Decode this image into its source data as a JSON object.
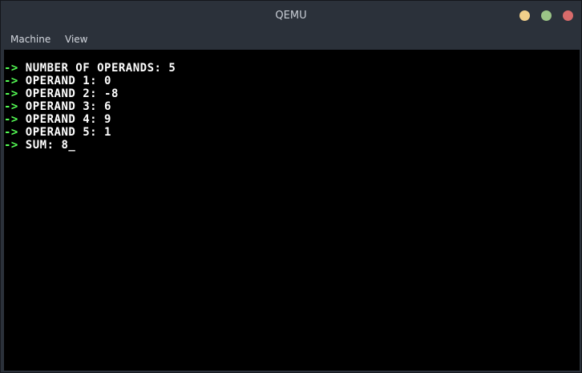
{
  "window": {
    "title": "QEMU",
    "buttons": {
      "minimize_color": "#f2d08a",
      "maximize_color": "#9bc487",
      "close_color": "#d86b6b"
    }
  },
  "menu": {
    "items": [
      {
        "label": "Machine"
      },
      {
        "label": "View"
      }
    ]
  },
  "terminal": {
    "prompt": "->",
    "prompt_color": "#55ff55",
    "text_color": "#ffffff",
    "cursor": "_",
    "lines": [
      "NUMBER OF OPERANDS: 5",
      "OPERAND 1: 0",
      "OPERAND 2: -8",
      "OPERAND 3: 6",
      "OPERAND 4: 9",
      "OPERAND 5: 1",
      "SUM: 8"
    ]
  }
}
